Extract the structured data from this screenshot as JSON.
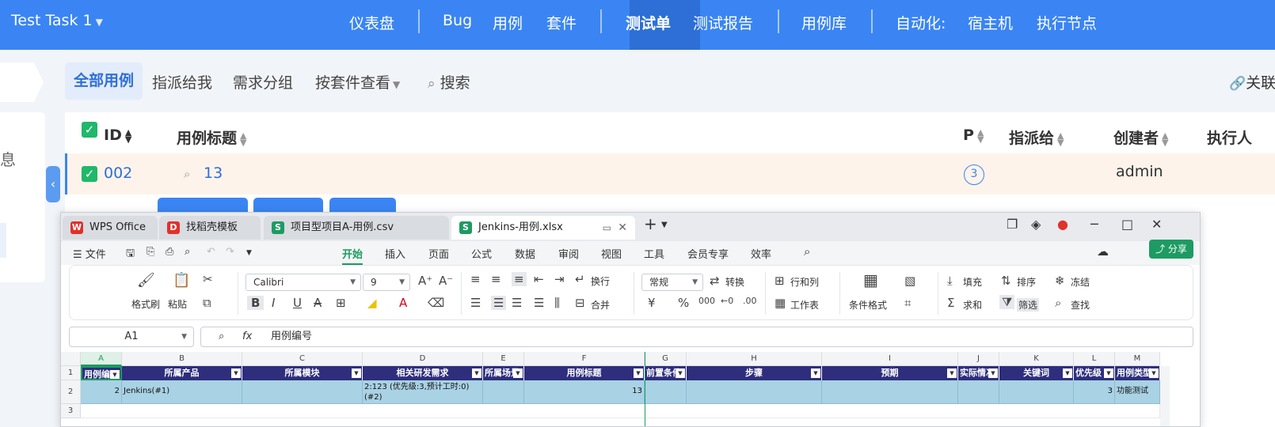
{
  "topnav": {
    "project": "Test Task 1",
    "items": [
      "仪表盘",
      "Bug",
      "用例",
      "套件",
      "测试单",
      "测试报告",
      "用例库",
      "自动化:",
      "宿主机",
      "执行节点"
    ],
    "active_item": "测试单"
  },
  "subnav": {
    "tabs": [
      "全部用例",
      "指派给我",
      "需求分组",
      "按套件查看",
      "搜索"
    ],
    "right_link": "关联",
    "left_panel_text": "息"
  },
  "table": {
    "headers": {
      "id": "ID",
      "title": "用例标题",
      "p": "P",
      "assignee": "指派给",
      "creator": "创建者",
      "executor": "执行人"
    },
    "row": {
      "id": "002",
      "title": "13",
      "p": "3",
      "assignee": "",
      "creator": "admin"
    }
  },
  "wps": {
    "tabs": [
      {
        "label": "WPS Office",
        "icon": "wps-logo-icon"
      },
      {
        "label": "找稻壳模板",
        "icon": "docer-icon"
      },
      {
        "label": "项目型项目A-用例.csv",
        "icon": "spreadsheet-icon"
      },
      {
        "label": "Jenkins-用例.xlsx",
        "icon": "spreadsheet-icon"
      }
    ],
    "menu": {
      "file": "文件",
      "items": [
        "开始",
        "插入",
        "页面",
        "公式",
        "数据",
        "审阅",
        "视图",
        "工具",
        "会员专享",
        "效率"
      ],
      "active": "开始",
      "share": "分享"
    },
    "ribbon": {
      "format_painter": "格式刷",
      "paste": "粘贴",
      "font_name": "Calibri",
      "font_size": "9",
      "wrap": "换行",
      "merge": "合并",
      "number_format": "常规",
      "convert": "转换",
      "row_col": "行和列",
      "worksheet": "工作表",
      "cond_format": "条件格式",
      "fill": "填充",
      "sort": "排序",
      "freeze": "冻结",
      "sum": "求和",
      "filter": "筛选",
      "find": "查找",
      "currency_symbol": "¥",
      "percent_symbol": "%"
    },
    "formula_bar": {
      "cell_ref": "A1",
      "fx": "fx",
      "content": "用例编号"
    },
    "sheet": {
      "columns": [
        "A",
        "B",
        "C",
        "D",
        "E",
        "F",
        "G",
        "H",
        "I",
        "J",
        "K",
        "L",
        "M"
      ],
      "rows": [
        "1",
        "2",
        "3"
      ],
      "header_row": [
        "用例编号",
        "所属产品",
        "所属模块",
        "相关研发需求",
        "所属场景",
        "用例标题",
        "前置条件",
        "步骤",
        "预期",
        "实际情况",
        "关键词",
        "优先级",
        "用例类型"
      ],
      "data_row": [
        "2",
        "Jenkins(#1)",
        "",
        "2:123 (优先级:3,预计工时:0)(#2)",
        "",
        "13",
        "",
        "",
        "",
        "",
        "",
        "3",
        "功能测试"
      ]
    }
  }
}
